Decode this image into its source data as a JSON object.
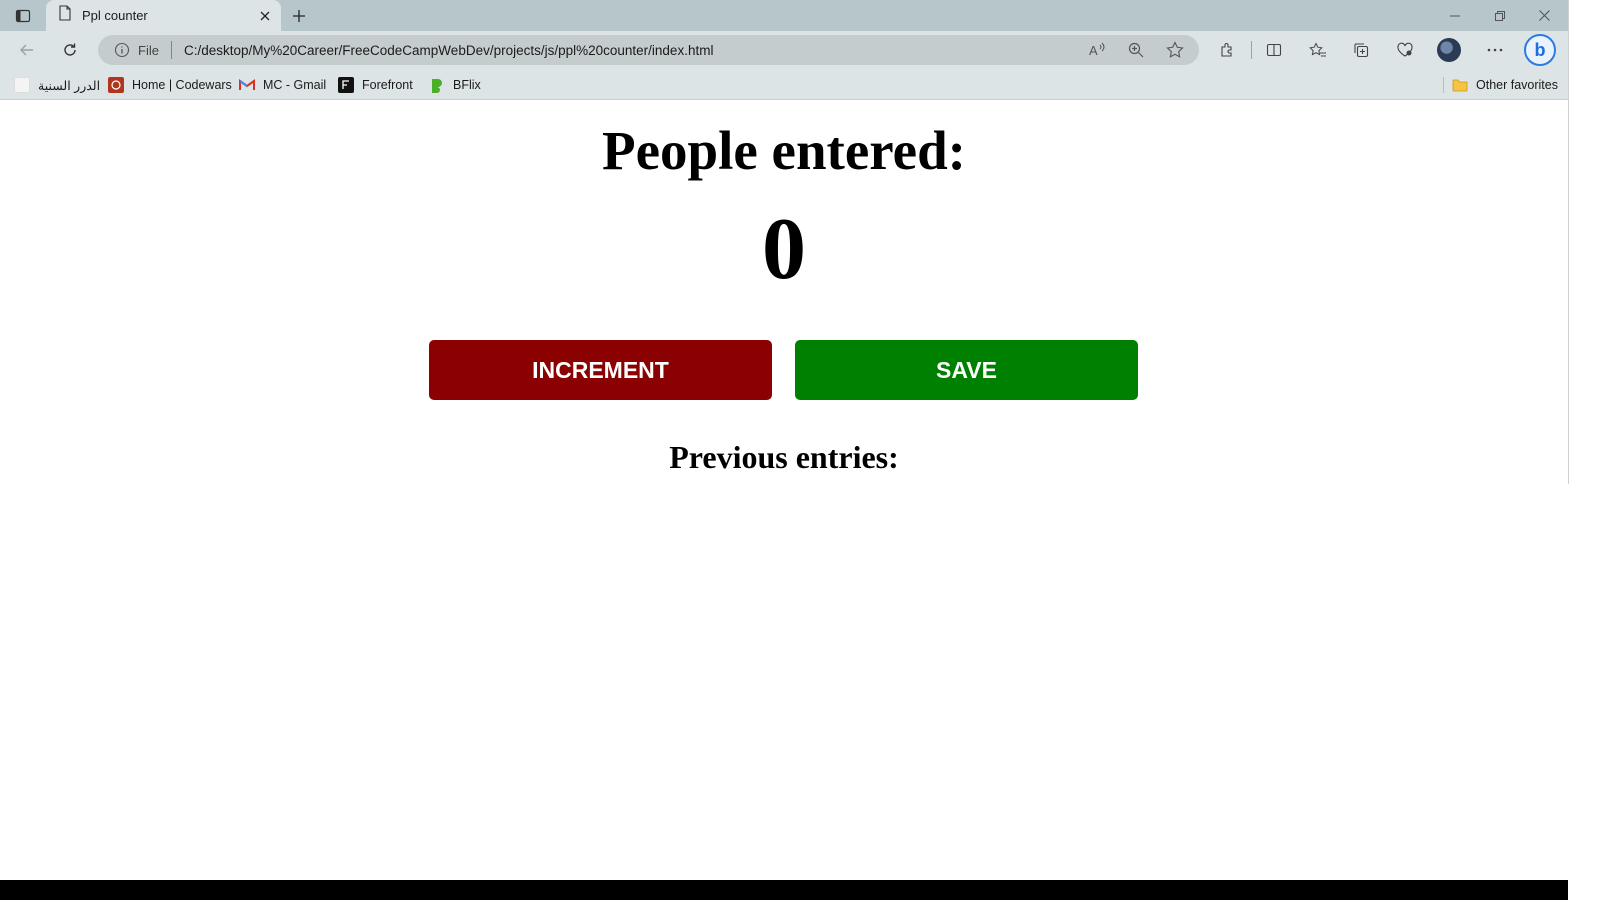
{
  "browser": {
    "tab": {
      "title": "Ppl counter"
    },
    "address": {
      "scheme": "File",
      "url": "C:/desktop/My%20Career/FreeCodeCampWebDev/projects/js/ppl%20counter/index.html"
    },
    "bookmarks": [
      {
        "label": "الدرر السنية",
        "icon": "page-icon"
      },
      {
        "label": "Home | Codewars",
        "icon": "codewars-icon"
      },
      {
        "label": "MC - Gmail",
        "icon": "gmail-icon"
      },
      {
        "label": "Forefront",
        "icon": "forefront-icon"
      },
      {
        "label": "BFlix",
        "icon": "bflix-icon"
      }
    ],
    "other_favorites": "Other favorites"
  },
  "page": {
    "heading": "People entered:",
    "count": "0",
    "increment_label": "INCREMENT",
    "save_label": "SAVE",
    "previous_heading": "Previous entries:",
    "previous_entries": ""
  },
  "colors": {
    "increment_button": "#8b0000",
    "save_button": "#008000",
    "tab_strip": "#b7c6cb",
    "toolbar": "#dde4e6"
  }
}
